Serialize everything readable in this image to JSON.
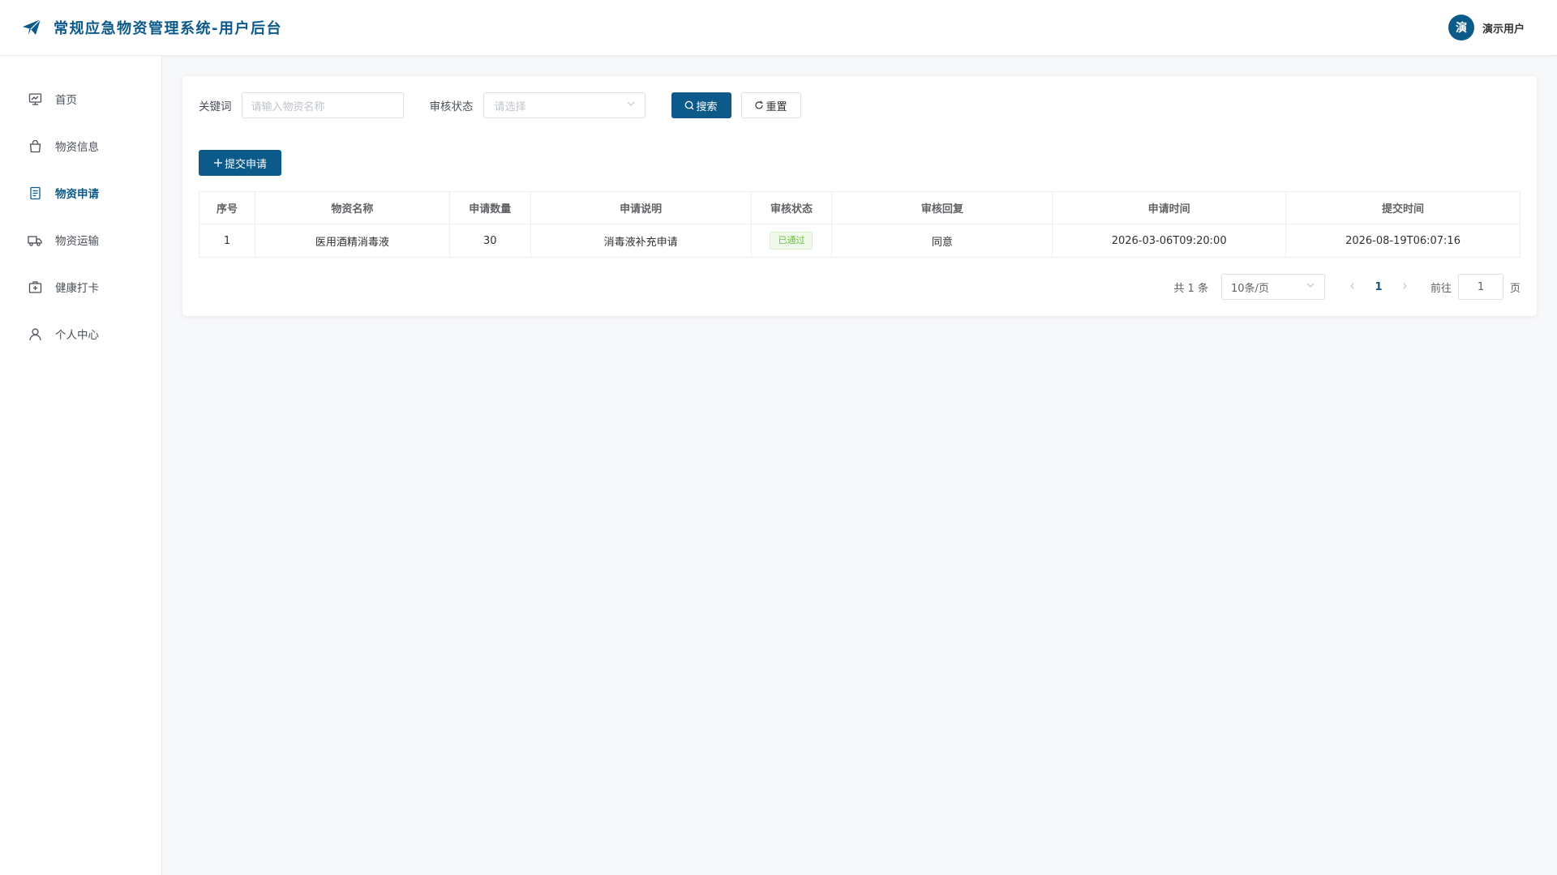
{
  "header": {
    "title": "常规应急物资管理系统-用户后台",
    "avatar_char": "演",
    "username": "演示用户",
    "accent": "#0b5a8a"
  },
  "sidebar": {
    "items": [
      {
        "label": "首页",
        "icon": "dashboard-icon",
        "active": false
      },
      {
        "label": "物资信息",
        "icon": "shopping-bag-icon",
        "active": false
      },
      {
        "label": "物资申请",
        "icon": "document-icon",
        "active": true
      },
      {
        "label": "物资运输",
        "icon": "truck-icon",
        "active": false
      },
      {
        "label": "健康打卡",
        "icon": "medical-box-icon",
        "active": false
      },
      {
        "label": "个人中心",
        "icon": "user-icon",
        "active": false
      }
    ]
  },
  "filters": {
    "keyword_label": "关键词",
    "keyword_placeholder": "请输入物资名称",
    "status_label": "审核状态",
    "status_placeholder": "请选择",
    "search_label": "搜索",
    "reset_label": "重置"
  },
  "actions": {
    "add_label": "提交申请"
  },
  "table": {
    "columns": [
      "序号",
      "物资名称",
      "申请数量",
      "申请说明",
      "审核状态",
      "审核回复",
      "申请时间",
      "提交时间"
    ],
    "rows": [
      {
        "index": "1",
        "name": "医用酒精消毒液",
        "quantity": "30",
        "description": "消毒液补充申请",
        "status": "已通过",
        "reply": "同意",
        "apply_time": "2026-03-06T09:20:00",
        "submit_time": "2026-08-19T06:07:16"
      }
    ]
  },
  "pagination": {
    "total_text": "共 1 条",
    "page_size": "10条/页",
    "current_page": "1",
    "goto_label": "前往",
    "goto_value": "1",
    "page_suffix": "页"
  }
}
